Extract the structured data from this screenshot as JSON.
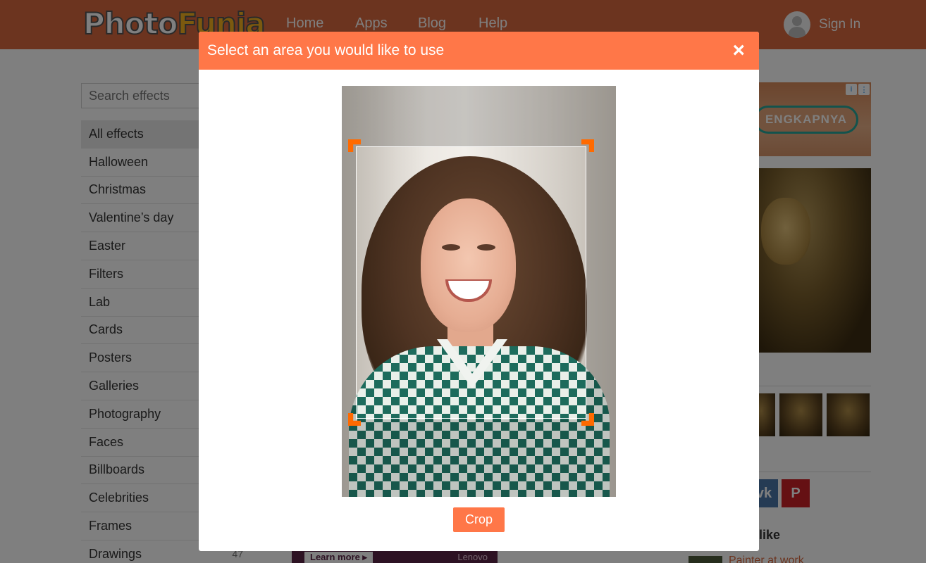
{
  "header": {
    "logo": {
      "part1": "Photo",
      "part2": "Funia"
    },
    "nav": [
      "Home",
      "Apps",
      "Blog",
      "Help"
    ],
    "signin_label": "Sign In"
  },
  "sidebar": {
    "search_placeholder": "Search effects",
    "categories": [
      {
        "label": "All effects",
        "count": ""
      },
      {
        "label": "Halloween",
        "count": ""
      },
      {
        "label": "Christmas",
        "count": ""
      },
      {
        "label": "Valentine’s day",
        "count": ""
      },
      {
        "label": "Easter",
        "count": ""
      },
      {
        "label": "Filters",
        "count": ""
      },
      {
        "label": "Lab",
        "count": ""
      },
      {
        "label": "Cards",
        "count": ""
      },
      {
        "label": "Posters",
        "count": ""
      },
      {
        "label": "Galleries",
        "count": ""
      },
      {
        "label": "Photography",
        "count": ""
      },
      {
        "label": "Faces",
        "count": ""
      },
      {
        "label": "Billboards",
        "count": ""
      },
      {
        "label": "Celebrities",
        "count": ""
      },
      {
        "label": "Frames",
        "count": ""
      },
      {
        "label": "Drawings",
        "count": "47"
      }
    ]
  },
  "right": {
    "ad_cta": "ENGKAPNYA",
    "ad_info": "i",
    "social": [
      "vk",
      "P"
    ],
    "like_text": "like",
    "painter_link": "Painter at work"
  },
  "bottom_ad": {
    "learn_more": "Learn more ▸",
    "brand": "Lenovo"
  },
  "modal": {
    "title": "Select an area you would like to use",
    "close": "×",
    "crop_label": "Crop"
  },
  "colors": {
    "brand": "#d9693f",
    "modal_header": "#ff7748",
    "handle": "#ff6a00"
  }
}
